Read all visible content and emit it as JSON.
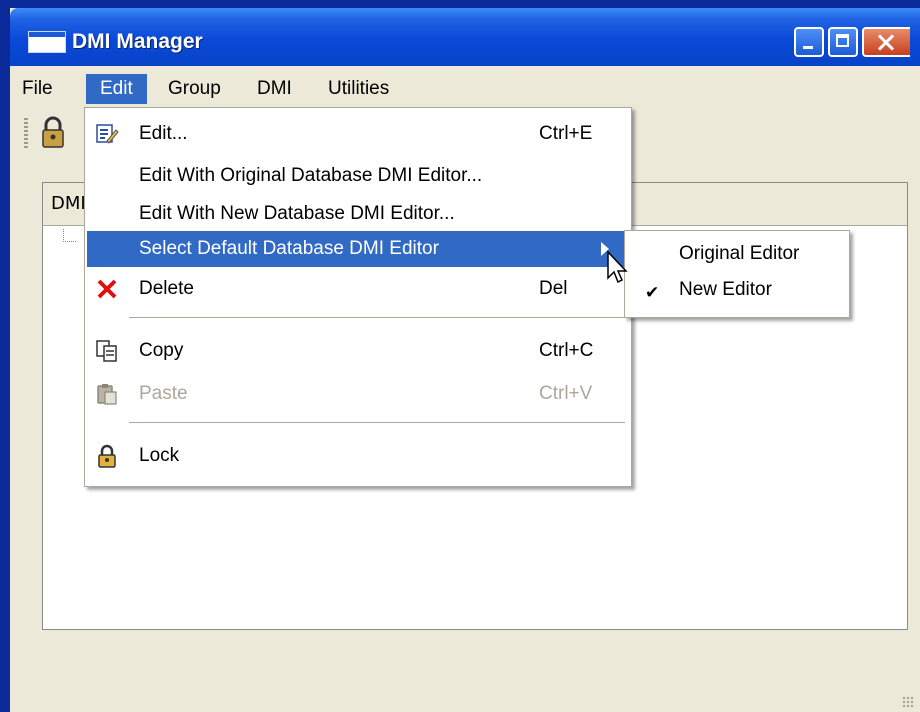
{
  "window": {
    "title": "DMI Manager"
  },
  "menubar": {
    "items": [
      {
        "label": "File"
      },
      {
        "label": "Edit"
      },
      {
        "label": "Group"
      },
      {
        "label": "DMI"
      },
      {
        "label": "Utilities"
      }
    ]
  },
  "panel": {
    "column_header": "DMI"
  },
  "edit_menu": {
    "items": [
      {
        "label": "Edit...",
        "shortcut": "Ctrl+E",
        "icon": "edit-icon"
      },
      {
        "label": "Edit With Original Database DMI Editor..."
      },
      {
        "label": "Edit With New Database DMI Editor..."
      },
      {
        "label": "Select Default Database DMI Editor",
        "has_submenu": true
      },
      {
        "label": "Delete",
        "shortcut": "Del",
        "icon": "delete-icon"
      },
      {
        "label": "Copy",
        "shortcut": "Ctrl+C",
        "icon": "copy-icon"
      },
      {
        "label": "Paste",
        "shortcut": "Ctrl+V",
        "icon": "paste-icon",
        "disabled": true
      },
      {
        "label": "Lock",
        "icon": "lock-icon"
      }
    ]
  },
  "submenu": {
    "items": [
      {
        "label": "Original Editor",
        "checked": false
      },
      {
        "label": "New Editor",
        "checked": true
      }
    ],
    "check_mark": "✔"
  },
  "colors": {
    "desktop": "#0a2a9a",
    "highlight": "#316ac5",
    "window_bg": "#ece9d8",
    "disabled_text": "#aca899",
    "delete_red": "#e01010"
  }
}
